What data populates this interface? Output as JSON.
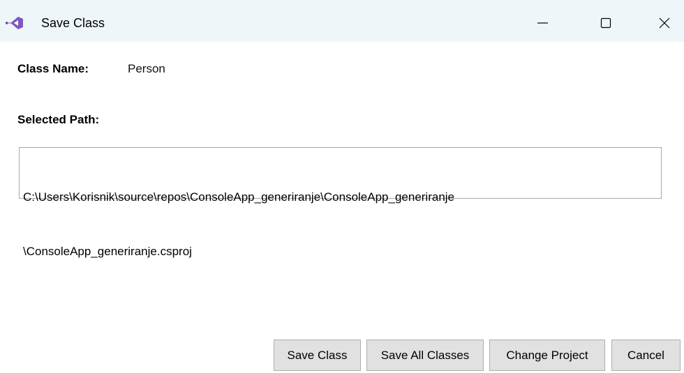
{
  "window": {
    "title": "Save Class",
    "icon": "visual-studio-icon",
    "controls": {
      "minimize": "minimize-icon",
      "maximize": "maximize-icon",
      "close": "close-icon"
    }
  },
  "class_name": {
    "label": "Class Name:",
    "value": "Person"
  },
  "selected_path": {
    "label": "Selected Path:",
    "line1": "C:\\Users\\Korisnik\\source\\repos\\ConsoleApp_generiranje\\ConsoleApp_generiranje",
    "line2": "\\ConsoleApp_generiranje.csproj"
  },
  "buttons": {
    "save_class": "Save Class",
    "save_all_classes": "Save All Classes",
    "change_project": "Change Project",
    "cancel": "Cancel"
  },
  "colors": {
    "titlebar_bg": "#eef6f9",
    "icon_purple": "#7e57c2",
    "button_bg": "#e1e1e1",
    "button_border": "#adadad"
  }
}
